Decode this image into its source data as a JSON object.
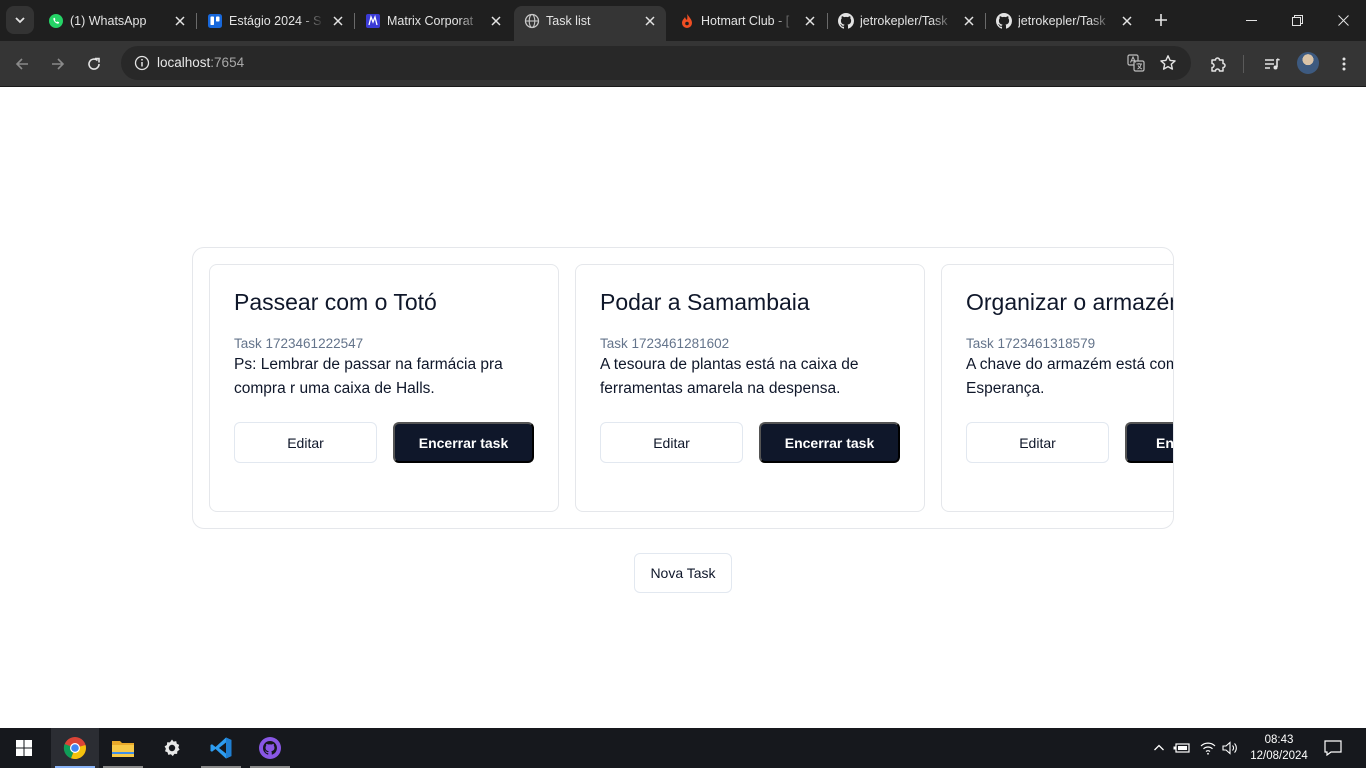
{
  "browser": {
    "tabs": [
      {
        "title": "(1) WhatsApp",
        "icon": "whatsapp-icon"
      },
      {
        "title": "Estágio 2024 - S",
        "icon": "trello-icon"
      },
      {
        "title": "Matrix Corporat",
        "icon": "matrix-icon"
      },
      {
        "title": "Task list",
        "icon": "globe-icon",
        "active": true
      },
      {
        "title": "Hotmart Club - [",
        "icon": "hotmart-icon"
      },
      {
        "title": "jetrokepler/Task",
        "icon": "github-icon"
      },
      {
        "title": "jetrokepler/Task",
        "icon": "github-icon"
      }
    ],
    "address": {
      "host": "localhost",
      "port": ":7654"
    },
    "colors": {
      "frame": "#1f1f1f",
      "toolbar": "#353535",
      "omnibox": "#282828"
    }
  },
  "page": {
    "tasks": [
      {
        "title": "Passear com o Totó",
        "id_label": "Task 1723461222547",
        "description": "Ps: Lembrar de passar na farmácia pra compra r uma caixa de Halls.",
        "edit_label": "Editar",
        "close_label": "Encerrar task"
      },
      {
        "title": "Podar a Samambaia",
        "id_label": "Task 1723461281602",
        "description": "A tesoura de plantas está na caixa de ferramentas amarela na despensa.",
        "edit_label": "Editar",
        "close_label": "Encerrar task"
      },
      {
        "title": "Organizar o armazém",
        "id_label": "Task 1723461318579",
        "description": "A chave do armazém está com Vila Esperança.",
        "edit_label": "Editar",
        "close_label": "Encerrar task"
      }
    ],
    "new_task_label": "Nova Task",
    "colors": {
      "primary": "#0f172a",
      "muted": "#64748b",
      "border": "#e5e7eb"
    }
  },
  "taskbar": {
    "apps": [
      "windows-start-icon",
      "chrome-icon",
      "file-explorer-icon",
      "settings-icon",
      "vscode-icon",
      "github-desktop-icon"
    ],
    "time": "08:43",
    "date": "12/08/2024"
  }
}
